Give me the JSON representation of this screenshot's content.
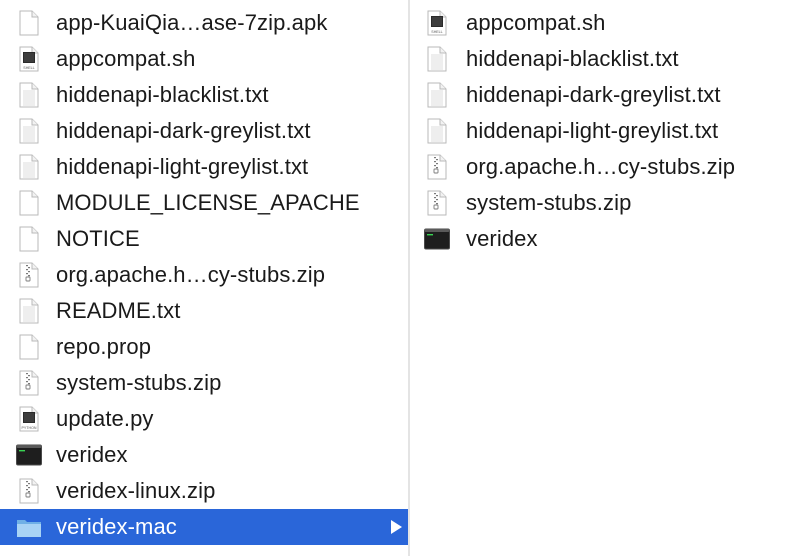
{
  "left_column": [
    {
      "label": "app-KuaiQia…ase-7zip.apk",
      "icon": "document-icon"
    },
    {
      "label": "appcompat.sh",
      "icon": "shell-script-icon",
      "badge": "SHELL"
    },
    {
      "label": "hiddenapi-blacklist.txt",
      "icon": "text-file-icon"
    },
    {
      "label": "hiddenapi-dark-greylist.txt",
      "icon": "text-file-icon"
    },
    {
      "label": "hiddenapi-light-greylist.txt",
      "icon": "text-file-icon"
    },
    {
      "label": "MODULE_LICENSE_APACHE",
      "icon": "document-icon"
    },
    {
      "label": "NOTICE",
      "icon": "document-icon"
    },
    {
      "label": "org.apache.h…cy-stubs.zip",
      "icon": "zip-archive-icon"
    },
    {
      "label": "README.txt",
      "icon": "text-file-icon"
    },
    {
      "label": "repo.prop",
      "icon": "document-icon"
    },
    {
      "label": "system-stubs.zip",
      "icon": "zip-archive-icon"
    },
    {
      "label": "update.py",
      "icon": "python-script-icon",
      "badge": "PYTHON"
    },
    {
      "label": "veridex",
      "icon": "terminal-executable-icon"
    },
    {
      "label": "veridex-linux.zip",
      "icon": "zip-archive-icon"
    },
    {
      "label": "veridex-mac",
      "icon": "folder-icon",
      "selected": true
    }
  ],
  "right_column": [
    {
      "label": "appcompat.sh",
      "icon": "shell-script-icon",
      "badge": "SHELL"
    },
    {
      "label": "hiddenapi-blacklist.txt",
      "icon": "text-file-icon"
    },
    {
      "label": "hiddenapi-dark-greylist.txt",
      "icon": "text-file-icon"
    },
    {
      "label": "hiddenapi-light-greylist.txt",
      "icon": "text-file-icon"
    },
    {
      "label": "org.apache.h…cy-stubs.zip",
      "icon": "zip-archive-icon"
    },
    {
      "label": "system-stubs.zip",
      "icon": "zip-archive-icon"
    },
    {
      "label": "veridex",
      "icon": "terminal-executable-icon"
    }
  ],
  "colors": {
    "selection": "#2a66d9",
    "text": "#1a1a1a",
    "selected_text": "#ffffff",
    "folder": "#8fc2ef"
  }
}
